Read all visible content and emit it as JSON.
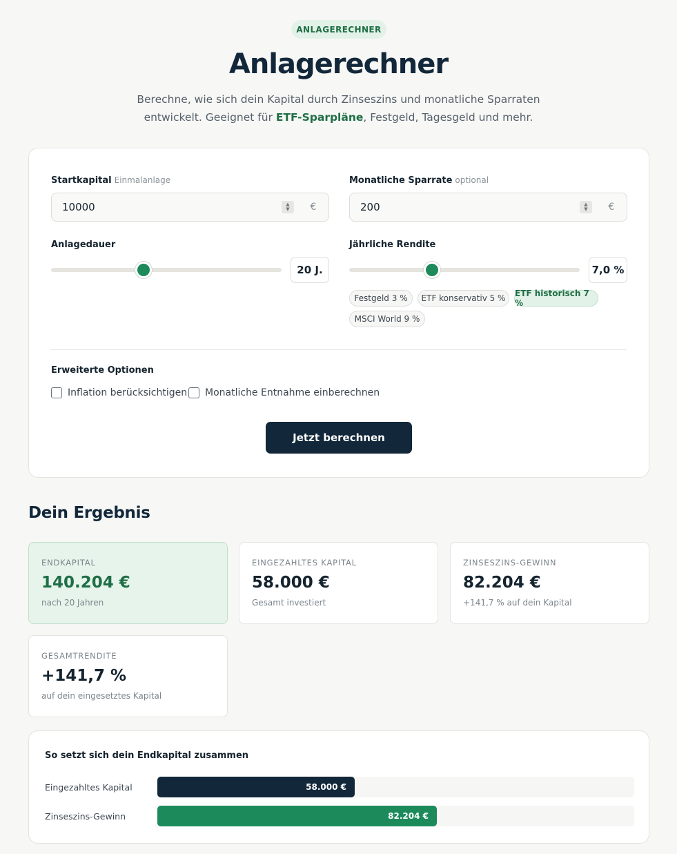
{
  "header": {
    "badge": "ANLAGERECHNER",
    "title": "Anlagerechner",
    "subtitle_line1": "Berechne, wie sich dein Kapital durch Zinseszins und monatliche Sparraten",
    "subtitle_line2_pre": "entwickelt. Geeignet für ",
    "subtitle_highlight": "ETF-Sparpläne",
    "subtitle_line2_post": ", Festgeld, Tagesgeld und mehr."
  },
  "form": {
    "startkapital": {
      "label": "Startkapital",
      "sublabel": "Einmalanlage",
      "value": "10000",
      "unit": "€"
    },
    "sparrate": {
      "label": "Monatliche Sparrate",
      "sublabel": "optional",
      "value": "200",
      "unit": "€"
    },
    "dauer": {
      "label": "Anlagedauer",
      "display": "20 J.",
      "level": 0.4
    },
    "rendite": {
      "label": "Jährliche Rendite",
      "display": "7,0 %",
      "level": 0.36
    },
    "presets": [
      {
        "label": "Festgeld 3 %",
        "active": false
      },
      {
        "label": "ETF konservativ 5 %",
        "active": false
      },
      {
        "label": "ETF historisch 7 %",
        "active": true
      },
      {
        "label": "MSCI World 9 %",
        "active": false
      }
    ],
    "advanced_title": "Erweiterte Optionen",
    "options": [
      {
        "label": "Inflation berücksichtigen",
        "checked": false
      },
      {
        "label": "Monatliche Entnahme einberechnen",
        "checked": false
      }
    ],
    "submit_label": "Jetzt berechnen"
  },
  "results": {
    "title": "Dein Ergebnis",
    "cards": [
      {
        "label": "ENDKAPITAL",
        "value": "140.204 €",
        "note": "nach 20 Jahren"
      },
      {
        "label": "EINGEZAHLTES KAPITAL",
        "value": "58.000 €",
        "note": "Gesamt investiert"
      },
      {
        "label": "ZINSESZINS-GEWINN",
        "value": "82.204 €",
        "note": "+141,7 % auf dein Kapital"
      },
      {
        "label": "GESAMTRENDITE",
        "value": "+141,7 %",
        "note": "auf dein eingesetztes Kapital"
      }
    ]
  },
  "composition": {
    "title": "So setzt sich dein Endkapital zusammen",
    "bars": [
      {
        "label": "Eingezahltes Kapital",
        "value_label": "58.000 €",
        "fraction": 0.414,
        "color": "#12283a"
      },
      {
        "label": "Zinseszins-Gewinn",
        "value_label": "82.204 €",
        "fraction": 0.586,
        "color": "#1c8a5a"
      }
    ]
  },
  "colors": {
    "accent": "#1c8a5a",
    "dark": "#12283a",
    "accent_soft": "#e3f2e8"
  }
}
